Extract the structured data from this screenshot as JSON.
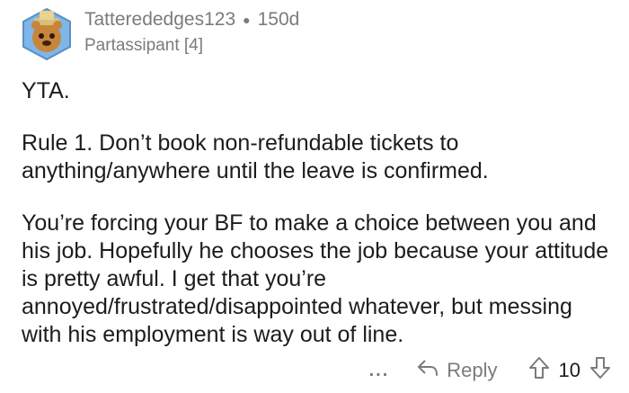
{
  "comment": {
    "username": "Tatterededges123",
    "age": "150d",
    "flair": "Partassipant [4]",
    "paragraphs": [
      "YTA.",
      "Rule 1. Don’t book non-refundable tickets to anything/anywhere until the leave is confirmed.",
      "You’re forcing your BF to make a choice between you and his job. Hopefully he chooses the job because your attitude is pretty awful. I get that you’re annoyed/frustrated/disappointed whatever, but messing with his employment is way out of line."
    ]
  },
  "actions": {
    "more_label": "...",
    "reply_label": "Reply",
    "vote_count": "10"
  },
  "colors": {
    "meta": "#787c7e",
    "text": "#1c1c1c"
  },
  "icons": [
    "avatar",
    "reply-arrow-icon",
    "upvote-icon",
    "downvote-icon"
  ]
}
